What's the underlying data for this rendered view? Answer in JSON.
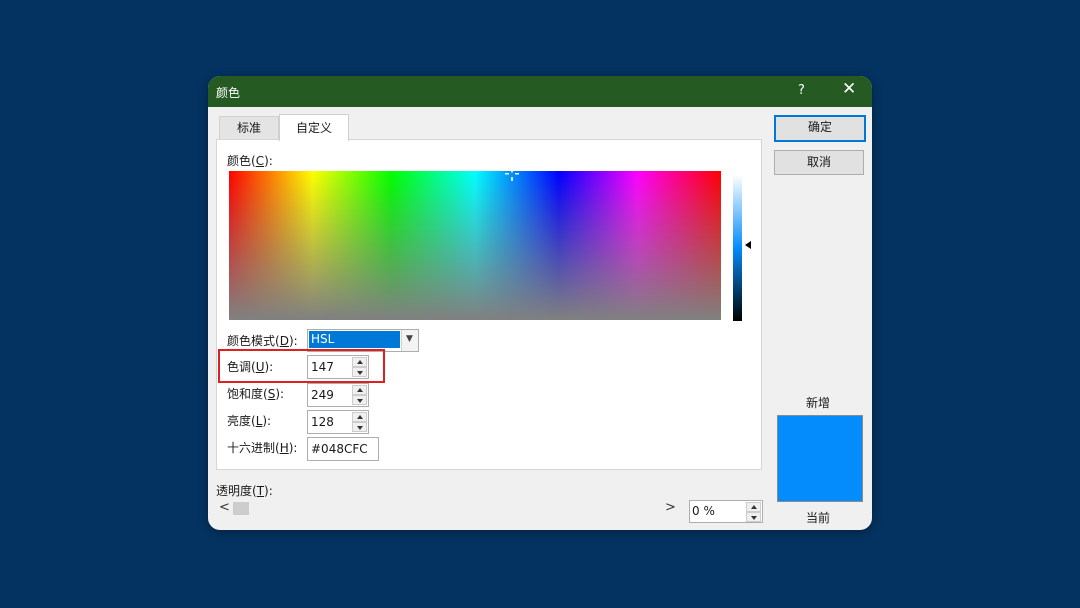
{
  "window": {
    "title": "颜色",
    "help_label": "?",
    "close_label": "✕"
  },
  "tabs": [
    {
      "label": "标准"
    },
    {
      "label": "自定义"
    }
  ],
  "colors": {
    "titlebar": "#265a23",
    "background": "#043361",
    "current_color": "#048cfc",
    "highlight_border": "#e02020"
  },
  "custom": {
    "colors_label": "颜色(C):",
    "colors_label_text": "颜色(",
    "colors_label_key": "C",
    "colors_label_end": "):",
    "mode_label_text": "颜色模式(",
    "mode_label_key": "D",
    "mode_label_end": "):",
    "mode_value": "HSL",
    "hue_label_text": "色调(",
    "hue_label_key": "U",
    "hue_label_end": "):",
    "hue_value": "147",
    "sat_label_text": "饱和度(",
    "sat_label_key": "S",
    "sat_label_end": "):",
    "sat_value": "249",
    "lum_label_text": "亮度(",
    "lum_label_key": "L",
    "lum_label_end": "):",
    "lum_value": "128",
    "hex_label_text": "十六进制(",
    "hex_label_key": "H",
    "hex_label_end": "):",
    "hex_value": "#048CFC"
  },
  "buttons": {
    "ok_label": "确定",
    "cancel_label": "取消"
  },
  "preview": {
    "new_label": "新增",
    "current_label": "当前"
  },
  "transparency": {
    "label_text": "透明度(",
    "label_key": "T",
    "label_end": "):",
    "value": "0 %",
    "scroll_left": "<",
    "scroll_right": ">"
  }
}
